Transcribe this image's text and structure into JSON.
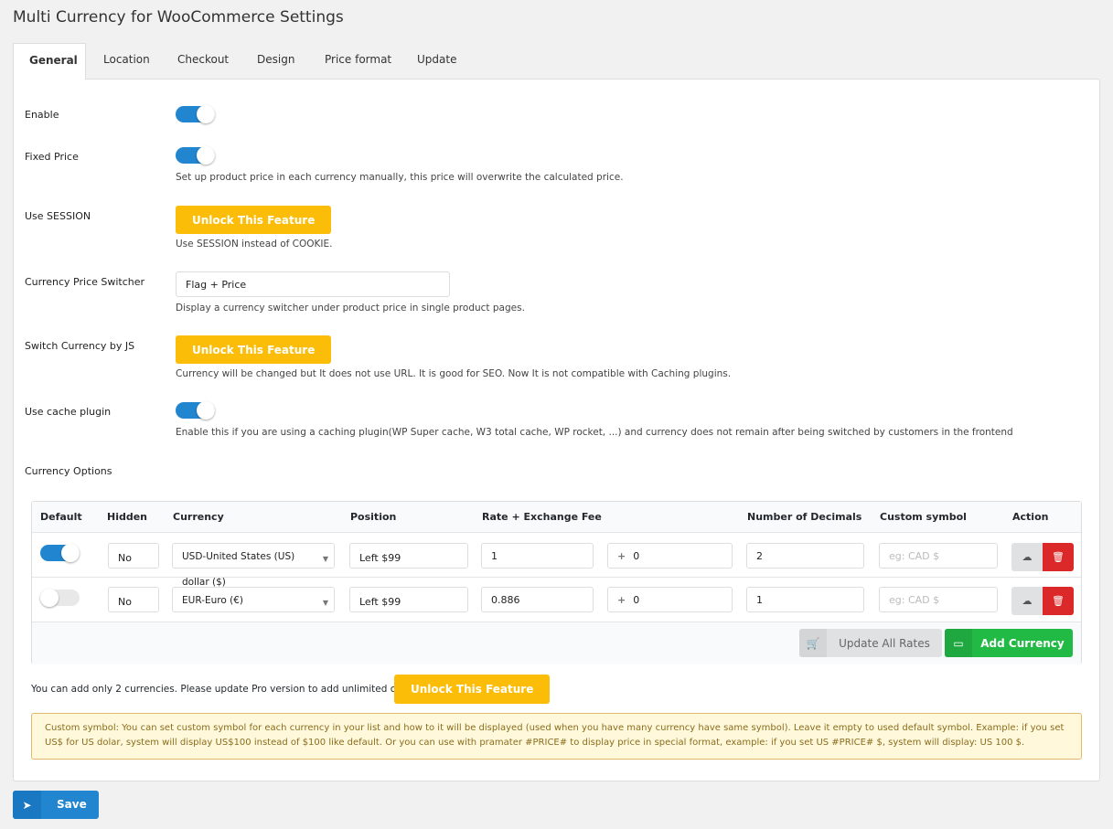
{
  "title": "Multi Currency for WooCommerce Settings",
  "tabs": [
    "General",
    "Location",
    "Checkout",
    "Design",
    "Price format",
    "Update"
  ],
  "settings": {
    "enable": {
      "label": "Enable",
      "on": true
    },
    "fixed_price": {
      "label": "Fixed Price",
      "on": true,
      "desc": "Set up product price in each currency manually, this price will overwrite the calculated price."
    },
    "use_session": {
      "label": "Use SESSION",
      "button": "Unlock This Feature",
      "desc": "Use SESSION instead of COOKIE."
    },
    "price_switcher": {
      "label": "Currency Price Switcher",
      "value": "Flag + Price",
      "desc": "Display a currency switcher under product price in single product pages."
    },
    "switch_js": {
      "label": "Switch Currency by JS",
      "button": "Unlock This Feature",
      "desc": "Currency will be changed but It does not use URL. It is good for SEO. Now It is not compatible with Caching plugins."
    },
    "cache_plugin": {
      "label": "Use cache plugin",
      "on": true,
      "desc": "Enable this if you are using a caching plugin(WP Super cache, W3 total cache, WP rocket, ...) and currency does not remain after being switched by customers in the frontend"
    },
    "currency_options": {
      "label": "Currency Options"
    }
  },
  "table": {
    "headers": [
      "Default",
      "Hidden",
      "Currency",
      "Position",
      "Rate + Exchange Fee",
      "Number of Decimals",
      "Custom symbol",
      "Action"
    ],
    "rows": [
      {
        "default": true,
        "hidden": "No",
        "currency": "USD-United States (US) dollar ($)",
        "position": "Left $99",
        "rate": "1",
        "fee": "0",
        "decimals": "2",
        "symbol_placeholder": "eg: CAD $"
      },
      {
        "default": false,
        "hidden": "No",
        "currency": "EUR-Euro (€)",
        "position": "Left $99",
        "rate": "0.886",
        "fee": "0",
        "decimals": "1",
        "symbol_placeholder": "eg: CAD $"
      }
    ],
    "update_rates": "Update All Rates",
    "add_currency": "Add Currency"
  },
  "limit_text": "You can add only 2 currencies. Please update Pro version to add unlimited currencies.",
  "limit_button": "Unlock This Feature",
  "note": "Custom symbol: You can set custom symbol for each currency in your list and how to it will be displayed (used when you have many currency have same symbol). Leave it empty to used default symbol. Example: if you set US$ for US dolar, system will display US$100 instead of $100 like default. Or you can use with pramater #PRICE# to display price in special format, example: if you set US #PRICE# $, system will display: US 100 $.",
  "save": "Save",
  "colors": {
    "primary": "#2185d0",
    "warning": "#fbbd08",
    "success": "#21ba45",
    "danger": "#db2828"
  }
}
